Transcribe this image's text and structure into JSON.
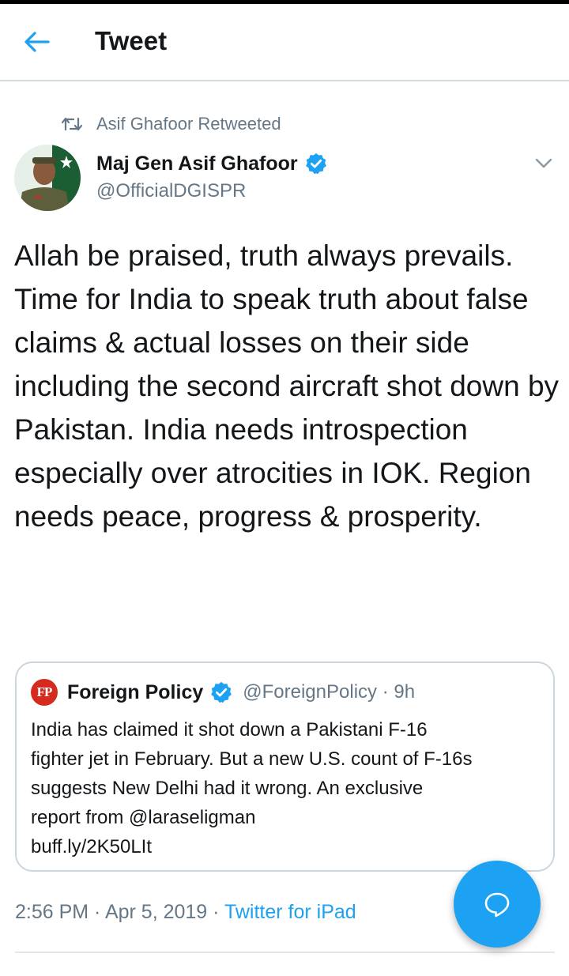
{
  "header": {
    "title": "Tweet",
    "back_icon": "arrow-left-icon"
  },
  "retweet": {
    "icon": "retweet-icon",
    "text": "Asif Ghafoor Retweeted"
  },
  "tweet": {
    "author_name": "Maj Gen Asif Ghafoor",
    "author_handle": "@OfficialDGISPR",
    "verified": true,
    "text": "Allah be praised, truth always prevails. Time for India to speak truth about false claims & actual losses on their side including the second aircraft shot down by Pakistan. India needs introspection especially over atrocities in IOK. Region needs peace, progress & prosperity.",
    "timestamp": "2:56 PM · Apr 5, 2019 · ",
    "source": "Twitter for iPad"
  },
  "quote": {
    "logo_text": "FP",
    "name": "Foreign Policy",
    "handle_time": "@ForeignPolicy · 9h",
    "verified": true,
    "lines": [
      "India has claimed it shot down a Pakistani F-16",
      "fighter jet in February. But a new U.S. count of F-16s",
      "suggests New Delhi had it wrong. An exclusive",
      "report from @laraseligman",
      "buff.ly/2K50LIt"
    ]
  },
  "colors": {
    "accent": "#1da1f2",
    "secondary_text": "#657786",
    "fp_red": "#d42b1e"
  },
  "fab": {
    "icon": "compose-reply-icon"
  }
}
